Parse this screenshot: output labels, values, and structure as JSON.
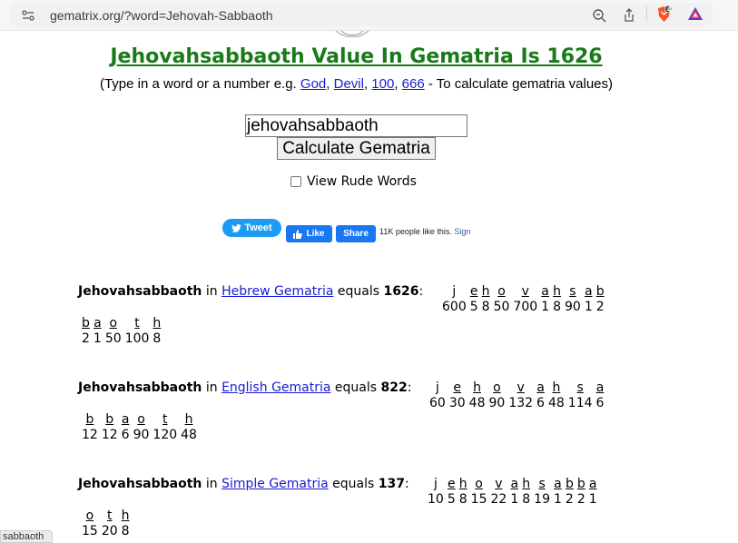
{
  "browser": {
    "url": "gematrix.org/?word=Jehovah-Sabbaoth",
    "brave_badge": "4",
    "status_tip": "sabbaoth"
  },
  "header": {
    "title": "Jehovahsabbaoth Value In Gematria Is 1626",
    "subtitle_prefix": "(Type in a word or a number e.g. ",
    "examples": [
      "God",
      "Devil",
      "100",
      "666"
    ],
    "subtitle_suffix": " - To calculate gematria values)"
  },
  "form": {
    "input_value": "jehovahsabbaoth",
    "button_label": "Calculate Gematria",
    "rude_label": "View Rude Words"
  },
  "social": {
    "tweet_label": "Tweet",
    "like_label": "Like",
    "share_label": "Share",
    "like_count_text": "11K people like this.",
    "sign_up_text": "Sign"
  },
  "results": [
    {
      "word": "Jehovahsabbaoth",
      "in_text": " in ",
      "cipher": "Hebrew Gematria",
      "equals_text": " equals ",
      "total": "1626",
      "row1": [
        [
          "j",
          "600"
        ],
        [
          "e",
          "5"
        ],
        [
          "h",
          "8"
        ],
        [
          "o",
          "50"
        ],
        [
          "v",
          "700"
        ],
        [
          "a",
          "1"
        ],
        [
          "h",
          "8"
        ],
        [
          "s",
          "90"
        ],
        [
          "a",
          "1"
        ],
        [
          "b",
          "2"
        ]
      ],
      "row2": [
        [
          "b",
          "2"
        ],
        [
          "a",
          "1"
        ],
        [
          "o",
          "50"
        ],
        [
          "t",
          "100"
        ],
        [
          "h",
          "8"
        ]
      ]
    },
    {
      "word": "Jehovahsabbaoth",
      "in_text": " in ",
      "cipher": "English Gematria",
      "equals_text": " equals ",
      "total": "822",
      "row1": [
        [
          "j",
          "60"
        ],
        [
          "e",
          "30"
        ],
        [
          "h",
          "48"
        ],
        [
          "o",
          "90"
        ],
        [
          "v",
          "132"
        ],
        [
          "a",
          "6"
        ],
        [
          "h",
          "48"
        ],
        [
          "s",
          "114"
        ],
        [
          "a",
          "6"
        ]
      ],
      "row2": [
        [
          "b",
          "12"
        ],
        [
          "b",
          "12"
        ],
        [
          "a",
          "6"
        ],
        [
          "o",
          "90"
        ],
        [
          "t",
          "120"
        ],
        [
          "h",
          "48"
        ]
      ]
    },
    {
      "word": "Jehovahsabbaoth",
      "in_text": " in ",
      "cipher": "Simple Gematria",
      "equals_text": " equals ",
      "total": "137",
      "row1": [
        [
          "j",
          "10"
        ],
        [
          "e",
          "5"
        ],
        [
          "h",
          "8"
        ],
        [
          "o",
          "15"
        ],
        [
          "v",
          "22"
        ],
        [
          "a",
          "1"
        ],
        [
          "h",
          "8"
        ],
        [
          "s",
          "19"
        ],
        [
          "a",
          "1"
        ],
        [
          "b",
          "2"
        ],
        [
          "b",
          "2"
        ],
        [
          "a",
          "1"
        ]
      ],
      "row2": [
        [
          "o",
          "15"
        ],
        [
          "t",
          "20"
        ],
        [
          "h",
          "8"
        ]
      ]
    }
  ]
}
